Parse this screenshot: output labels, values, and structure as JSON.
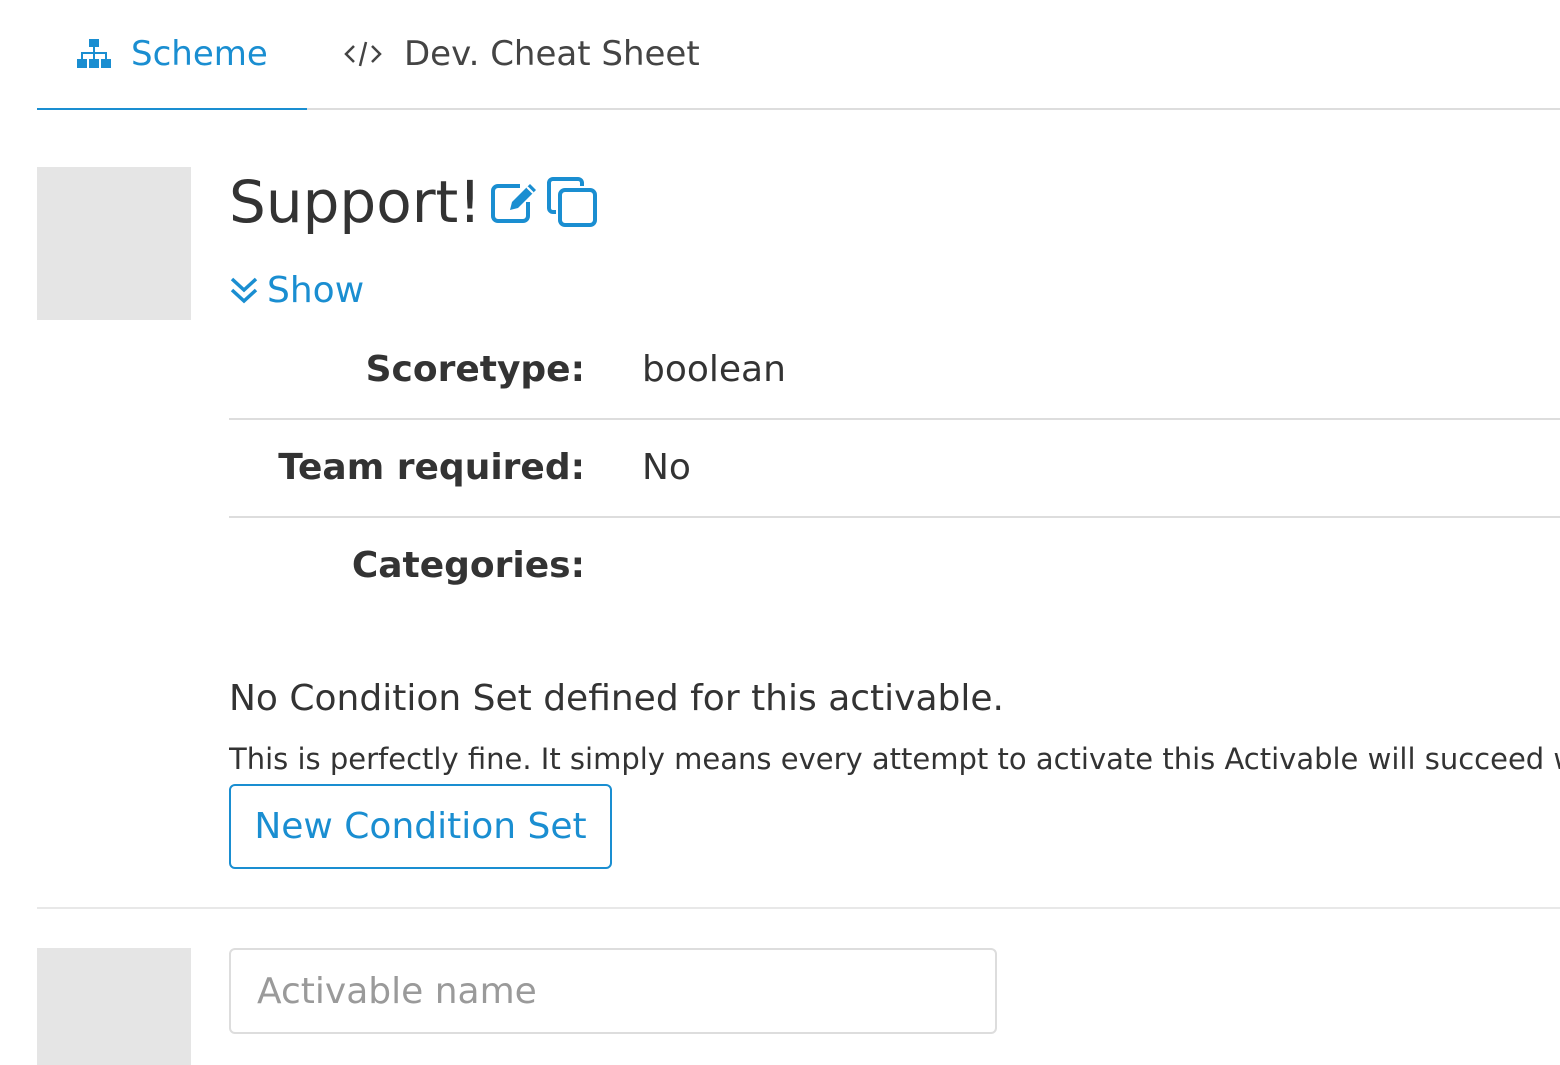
{
  "tabs": [
    {
      "label": "Scheme",
      "icon": "sitemap-icon",
      "active": true
    },
    {
      "label": "Dev. Cheat Sheet",
      "icon": "code-icon",
      "active": false
    }
  ],
  "activable": {
    "title": "Support!",
    "edit_icon": "edit-icon",
    "copy_icon": "copy-icon",
    "show_label": "Show",
    "properties": [
      {
        "label": "Scoretype:",
        "value": "boolean"
      },
      {
        "label": "Team required:",
        "value": "No"
      },
      {
        "label": "Categories:",
        "value": ""
      }
    ],
    "no_condition_title": "No Condition Set defined for this activable.",
    "no_condition_desc": "This is perfectly fine. It simply means every attempt to activate this Activable will succeed without any",
    "new_condition_button": "New Condition Set"
  },
  "new_activable": {
    "placeholder": "Activable name"
  },
  "colors": {
    "accent": "#1a8ed1",
    "thumbnail": "#e5e5e5",
    "text": "#333333",
    "divider": "#dddddd"
  }
}
